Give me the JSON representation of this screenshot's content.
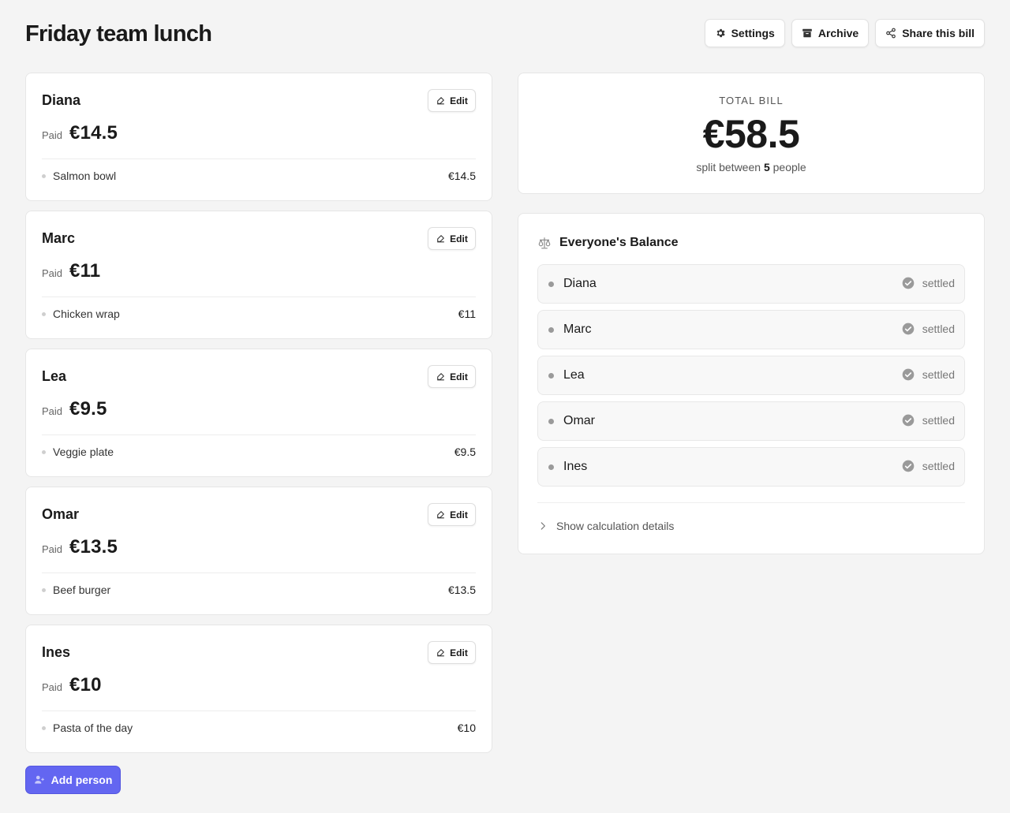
{
  "header": {
    "title": "Friday team lunch",
    "buttons": [
      {
        "label": "Settings",
        "icon": "gear-icon"
      },
      {
        "label": "Archive",
        "icon": "archive-icon"
      },
      {
        "label": "Share this bill",
        "icon": "share-icon"
      }
    ]
  },
  "people": [
    {
      "name": "Diana",
      "edit_label": "Edit",
      "paid_label": "Paid",
      "paid": "€14.5",
      "items": [
        {
          "name": "Salmon bowl",
          "price": "€14.5"
        }
      ]
    },
    {
      "name": "Marc",
      "edit_label": "Edit",
      "paid_label": "Paid",
      "paid": "€11",
      "items": [
        {
          "name": "Chicken wrap",
          "price": "€11"
        }
      ]
    },
    {
      "name": "Lea",
      "edit_label": "Edit",
      "paid_label": "Paid",
      "paid": "€9.5",
      "items": [
        {
          "name": "Veggie plate",
          "price": "€9.5"
        }
      ]
    },
    {
      "name": "Omar",
      "edit_label": "Edit",
      "paid_label": "Paid",
      "paid": "€13.5",
      "items": [
        {
          "name": "Beef burger",
          "price": "€13.5"
        }
      ]
    },
    {
      "name": "Ines",
      "edit_label": "Edit",
      "paid_label": "Paid",
      "paid": "€10",
      "items": [
        {
          "name": "Pasta of the day",
          "price": "€10"
        }
      ]
    }
  ],
  "add_person_label": "Add person",
  "total": {
    "label": "TOTAL BILL",
    "amount": "€58.5",
    "split_prefix": "split between",
    "count": "5",
    "split_suffix": "people"
  },
  "balance": {
    "title": "Everyone's Balance",
    "icon": "scale-icon",
    "rows": [
      {
        "name": "Diana",
        "status": "settled"
      },
      {
        "name": "Marc",
        "status": "settled"
      },
      {
        "name": "Lea",
        "status": "settled"
      },
      {
        "name": "Omar",
        "status": "settled"
      },
      {
        "name": "Ines",
        "status": "settled"
      }
    ],
    "details_label": "Show calculation details"
  },
  "colors": {
    "accent": "#6366f1",
    "background": "#f4f4f4",
    "card": "#ffffff",
    "status": "#9a9a9a"
  }
}
